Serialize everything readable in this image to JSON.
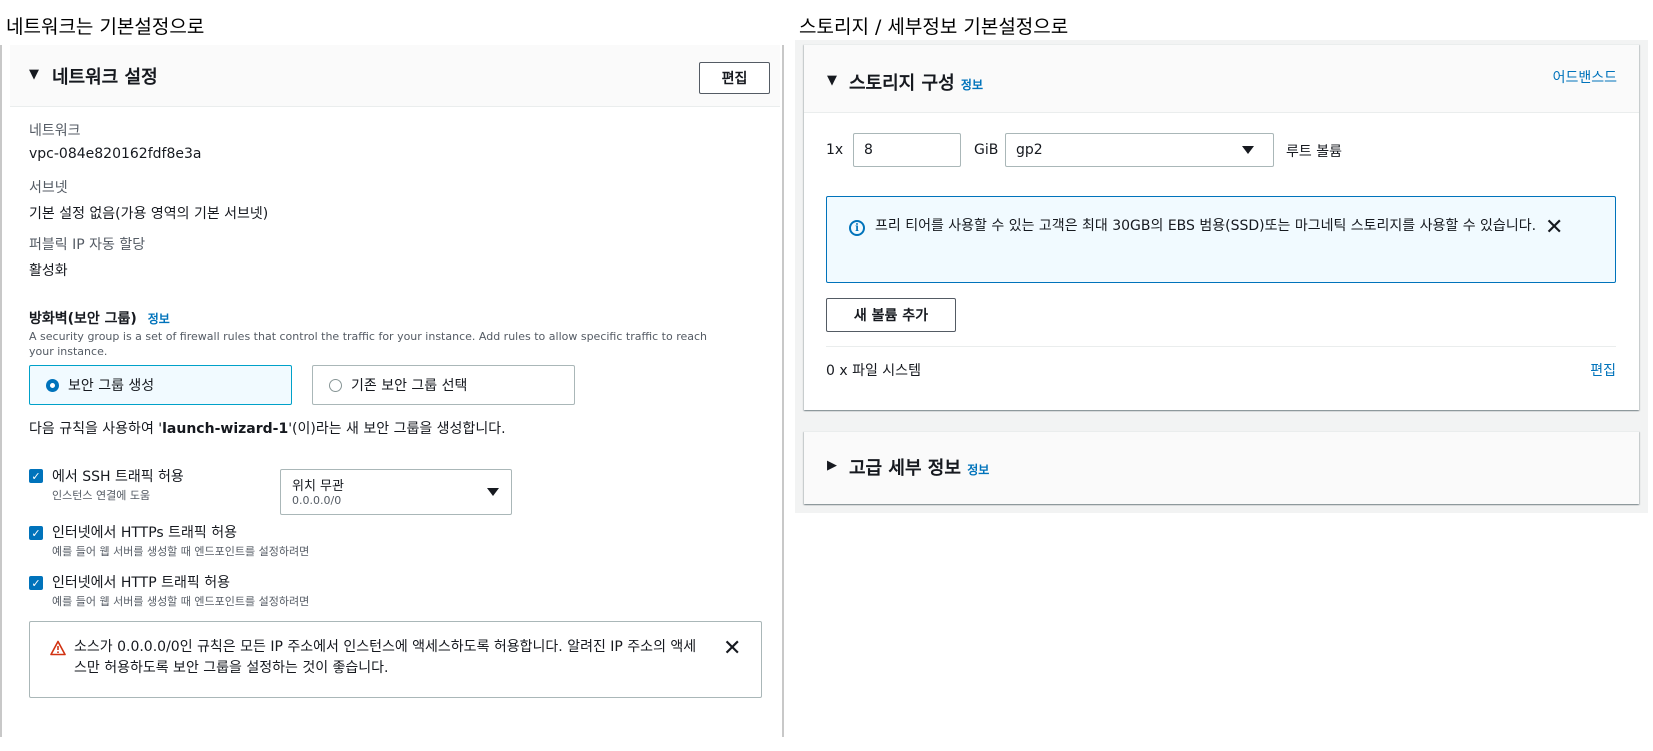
{
  "captions": {
    "left": "네트워크는 기본설정으로",
    "right": "스토리지 / 세부정보 기본설정으로"
  },
  "network": {
    "title": "네트워크 설정",
    "edit_label": "편집",
    "network_label": "네트워크",
    "network_value": "vpc-084e820162fdf8e3a",
    "subnet_label": "서브넷",
    "subnet_value": "기본 설정 없음(가용 영역의 기본 서브넷)",
    "public_ip_label": "퍼블릭 IP 자동 할당",
    "public_ip_value": "활성화",
    "firewall_title": "방화벽(보안 그룹)",
    "info_label": "정보",
    "firewall_desc": "A security group is a set of firewall rules that control the traffic for your instance. Add rules to allow specific traffic to reach your instance.",
    "radio_create": "보안 그룹 생성",
    "radio_existing": "기존 보안 그룹 선택",
    "rule_prefix": "다음 규칙을 사용하여 '",
    "rule_name": "launch-wizard-1",
    "rule_suffix": "'(이)라는 새 보안 그룹을 생성합니다.",
    "rules": [
      {
        "label": "에서 SSH 트래픽 허용",
        "sub": "인스턴스 연결에 도움",
        "checked": true
      },
      {
        "label": "인터넷에서 HTTPs 트래픽 허용",
        "sub": "예를 들어 웹 서버를 생성할 때 엔드포인트를 설정하려면",
        "checked": true
      },
      {
        "label": "인터넷에서 HTTP 트래픽 허용",
        "sub": "예를 들어 웹 서버를 생성할 때 엔드포인트를 설정하려면",
        "checked": true
      }
    ],
    "ssh_source": "위치 무관",
    "ssh_cidr": "0.0.0.0/0",
    "warning": "소스가 0.0.0.0/0인 규칙은 모든 IP 주소에서 인스턴스에 액세스하도록 허용합니다. 알려진 IP 주소의 액세스만 허용하도록 보안 그룹을 설정하는 것이 좋습니다."
  },
  "storage": {
    "title": "스토리지 구성",
    "info_label": "정보",
    "advanced_label": "어드밴스드",
    "volume_count": "1x",
    "volume_size": "8",
    "unit": "GiB",
    "volume_type": "gp2",
    "root_label": "루트 볼륨",
    "info_text": "프리 티어를 사용할 수 있는 고객은 최대 30GB의 EBS 범용(SSD)또는 마그네틱 스토리지를 사용할 수 있습니다.",
    "add_volume_label": "새 볼륨 추가",
    "filesystem_label": "0 x 파일 시스템",
    "edit_label": "편집"
  },
  "advanced": {
    "title": "고급 세부 정보",
    "info_label": "정보"
  },
  "colors": {
    "link": "#0073bb",
    "warning": "#d13212",
    "info_bg": "#f1faff"
  },
  "icons": {
    "warning": "warning-triangle-icon",
    "info": "info-circle-icon",
    "close": "close-icon",
    "caret": "caret-down-icon",
    "expand": "triangle-expanded-icon",
    "collapse": "triangle-collapsed-icon"
  }
}
